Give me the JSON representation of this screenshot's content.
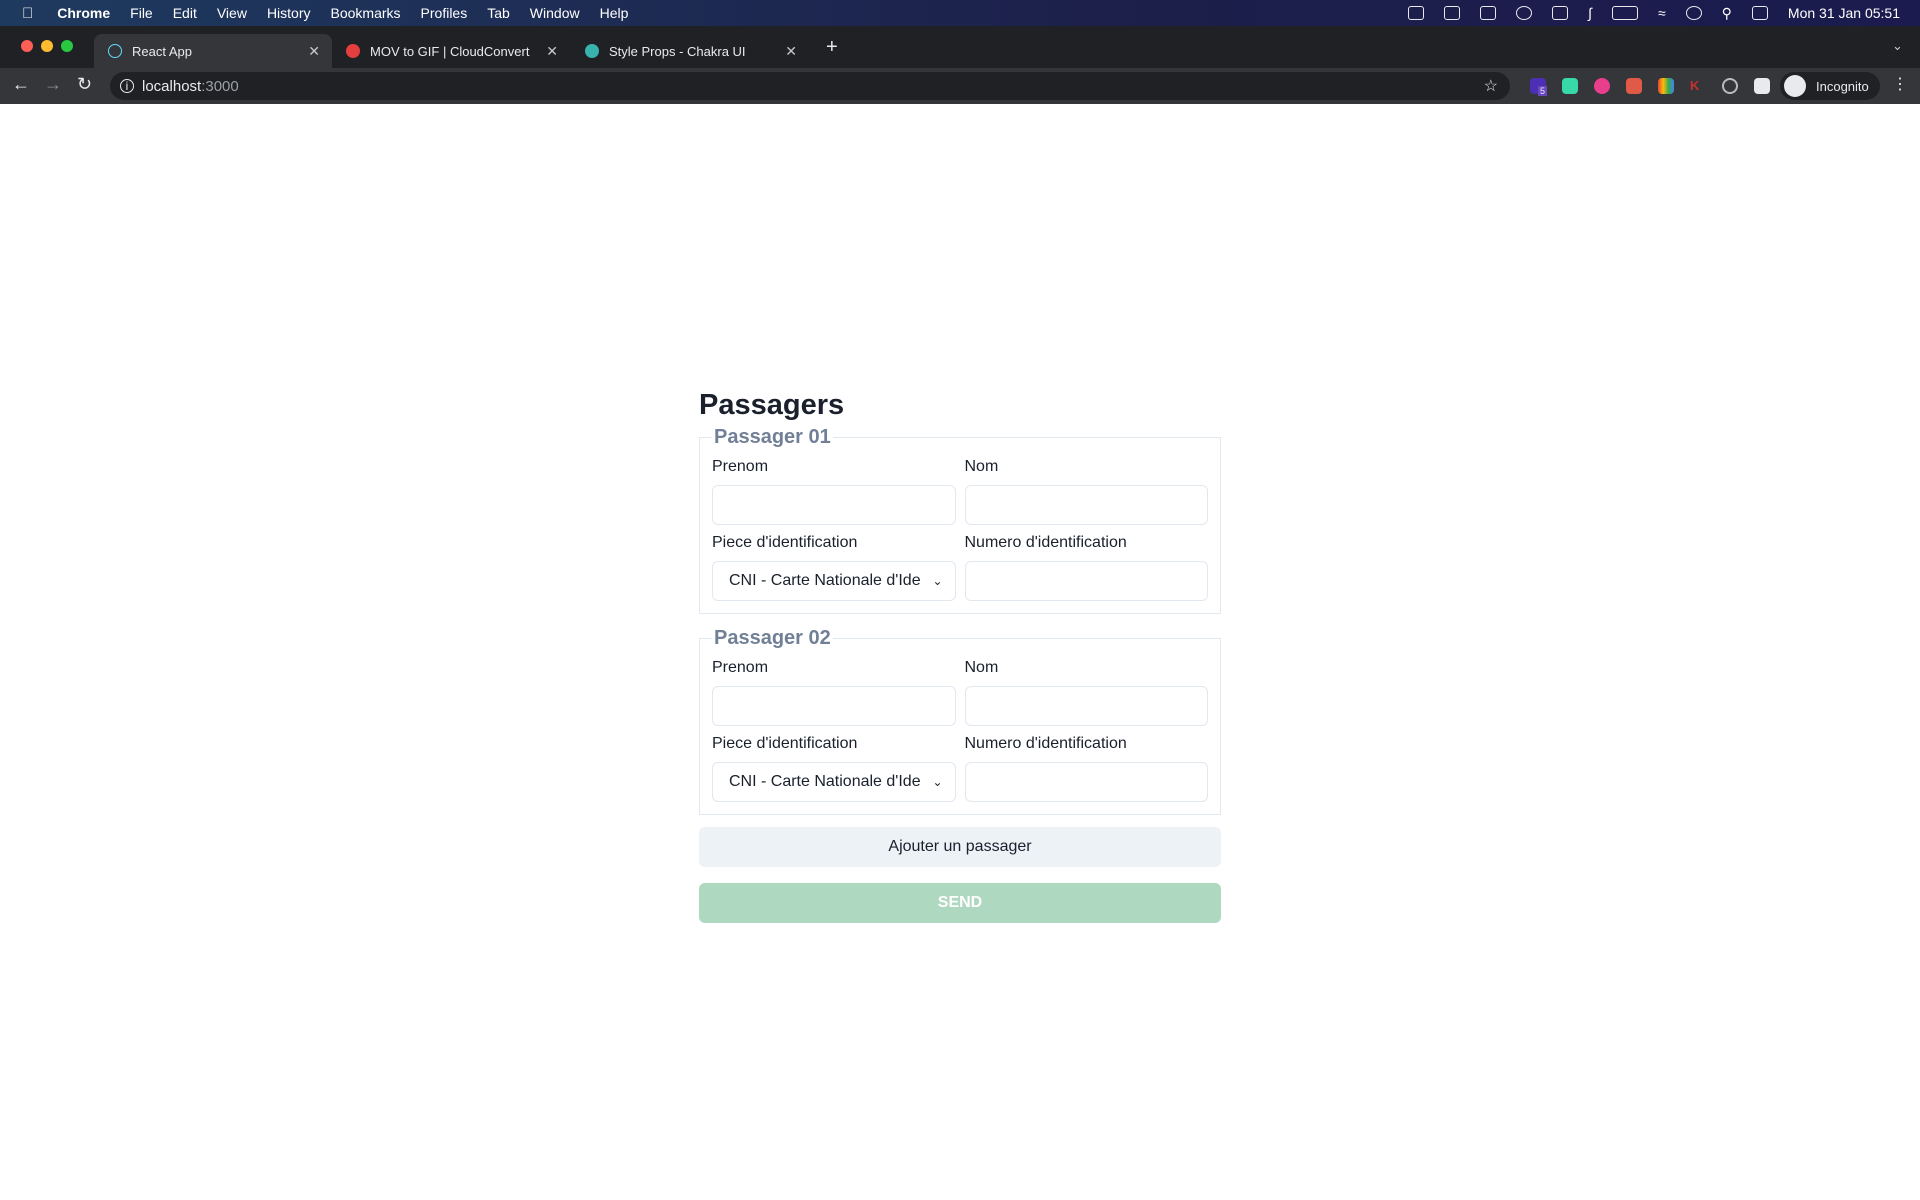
{
  "menubar": {
    "app": "Chrome",
    "items": [
      "File",
      "Edit",
      "View",
      "History",
      "Bookmarks",
      "Profiles",
      "Tab",
      "Window",
      "Help"
    ],
    "clock": "Mon 31 Jan  05:51"
  },
  "tabs": [
    {
      "title": "React App",
      "color": "#61dafb"
    },
    {
      "title": "MOV to GIF | CloudConvert",
      "color": "#e53e3e"
    },
    {
      "title": "Style Props - Chakra UI",
      "color": "#38b2ac"
    }
  ],
  "toolbar": {
    "host": "localhost",
    "port": ":3000",
    "profile": "Incognito",
    "extension_badge": "5"
  },
  "page": {
    "title": "Passagers",
    "passengers": [
      {
        "legend": "Passager 01",
        "prenom_label": "Prenom",
        "nom_label": "Nom",
        "piece_label": "Piece d'identification",
        "piece_value": "CNI - Carte Nationale d'Ide",
        "numero_label": "Numero d'identification"
      },
      {
        "legend": "Passager 02",
        "prenom_label": "Prenom",
        "nom_label": "Nom",
        "piece_label": "Piece d'identification",
        "piece_value": "CNI - Carte Nationale d'Ide",
        "numero_label": "Numero d'identification"
      }
    ],
    "add_label": "Ajouter un passager",
    "send_label": "SEND"
  }
}
